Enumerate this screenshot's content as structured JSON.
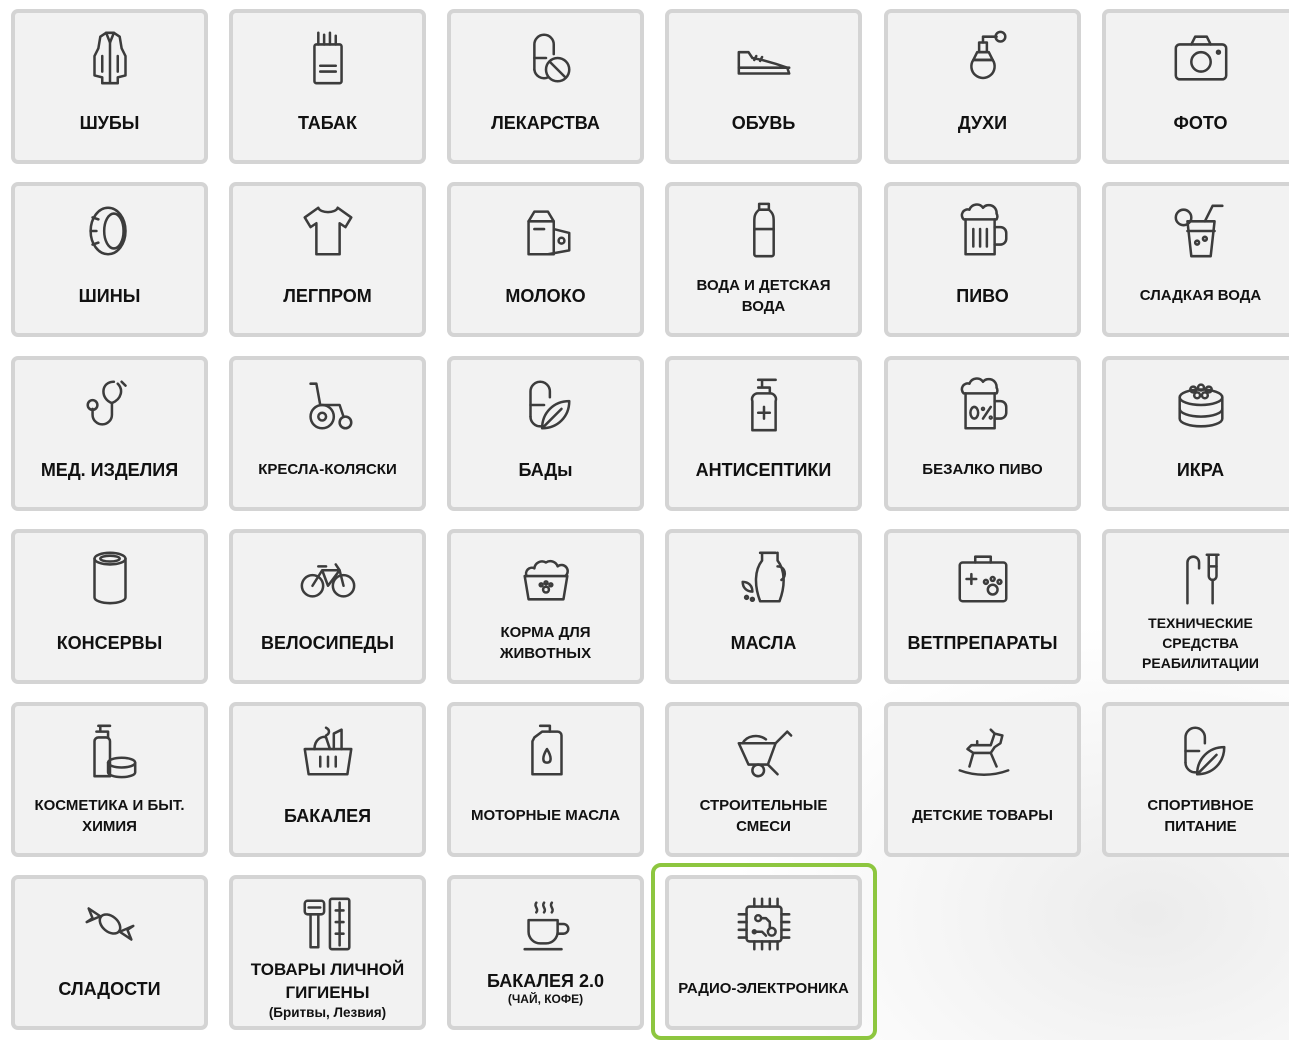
{
  "tiles": [
    {
      "label": "ШУБЫ",
      "icon": "fur-coat-icon"
    },
    {
      "label": "ТАБАК",
      "icon": "tobacco-icon"
    },
    {
      "label": "ЛЕКАРСТВА",
      "icon": "medicine-icon"
    },
    {
      "label": "ОБУВЬ",
      "icon": "shoe-icon"
    },
    {
      "label": "ДУХИ",
      "icon": "perfume-icon"
    },
    {
      "label": "ФОТО",
      "icon": "camera-icon"
    },
    {
      "label": "ШИНЫ",
      "icon": "tire-icon"
    },
    {
      "label": "ЛЕГПРОМ",
      "icon": "tshirt-icon"
    },
    {
      "label": "МОЛОКО",
      "icon": "milk-icon"
    },
    {
      "label": "ВОДА И ДЕТСКАЯ ВОДА",
      "icon": "water-bottle-icon"
    },
    {
      "label": "ПИВО",
      "icon": "beer-mug-icon"
    },
    {
      "label": "СЛАДКАЯ ВОДА",
      "icon": "soda-glass-icon"
    },
    {
      "label": "МЕД. ИЗДЕЛИЯ",
      "icon": "stethoscope-icon"
    },
    {
      "label": "КРЕСЛА-КОЛЯСКИ",
      "icon": "wheelchair-icon"
    },
    {
      "label": "БАДы",
      "icon": "supplement-capsule-icon"
    },
    {
      "label": "АНТИСЕПТИКИ",
      "icon": "antiseptic-icon"
    },
    {
      "label": "БЕЗАЛКО ПИВО",
      "icon": "non-alcoholic-beer-icon"
    },
    {
      "label": "ИКРА",
      "icon": "caviar-icon"
    },
    {
      "label": "КОНСЕРВЫ",
      "icon": "can-icon"
    },
    {
      "label": "ВЕЛОСИПЕДЫ",
      "icon": "bicycle-icon"
    },
    {
      "label": "КОРМА ДЛЯ ЖИВОТНЫХ",
      "icon": "pet-food-icon"
    },
    {
      "label": "МАСЛА",
      "icon": "oil-jug-icon"
    },
    {
      "label": "ВЕТПРЕПАРАТЫ",
      "icon": "vet-kit-icon"
    },
    {
      "label": "ТЕХНИЧЕСКИЕ СРЕДСТВА РЕАБИЛИТАЦИИ",
      "icon": "crutch-icon"
    },
    {
      "label": "КОСМЕТИКА И БЫТ. ХИМИЯ",
      "icon": "cosmetics-icon"
    },
    {
      "label": "БАКАЛЕЯ",
      "icon": "grocery-basket-icon"
    },
    {
      "label": "МОТОРНЫЕ МАСЛА",
      "icon": "motor-oil-icon"
    },
    {
      "label": "СТРОИТЕЛЬНЫЕ СМЕСИ",
      "icon": "wheelbarrow-icon"
    },
    {
      "label": "ДЕТСКИЕ ТОВАРЫ",
      "icon": "rocking-horse-icon"
    },
    {
      "label": "СПОРТИВНОЕ ПИТАНИЕ",
      "icon": "sport-nutrition-icon"
    },
    {
      "label": "СЛАДОСТИ",
      "icon": "candy-icon"
    },
    {
      "label": "ТОВАРЫ ЛИЧНОЙ ГИГИЕНЫ",
      "sub": "(Бритвы, Лезвия)",
      "icon": "razor-icon"
    },
    {
      "label": "БАКАЛЕЯ 2.0",
      "sub": "(ЧАЙ, КОФЕ)",
      "icon": "coffee-cup-icon"
    },
    {
      "label": "РАДИО-ЭЛЕКТРОНИКА",
      "icon": "chip-icon"
    }
  ],
  "selected_tile": "РАДИО-ЭЛЕКТРОНИКА",
  "colors": {
    "selected_border": "#8dc63f",
    "tile_bg": "#f2f2f2",
    "tile_border": "#d4d4d4",
    "icon": "#3c3c3c"
  }
}
